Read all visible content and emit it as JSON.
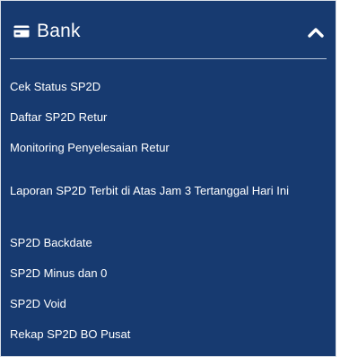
{
  "panel": {
    "title": "Bank",
    "icon": "credit-card-icon",
    "toggle_icon": "chevron-up-icon",
    "background_color": "#173a70"
  },
  "menu": {
    "items": [
      {
        "label": "Cek Status SP2D"
      },
      {
        "label": "Daftar SP2D Retur"
      },
      {
        "label": "Monitoring Penyelesaian Retur"
      },
      {
        "label": "Laporan SP2D Terbit di Atas Jam 3 Tertanggal Hari Ini"
      },
      {
        "label": "SP2D Backdate"
      },
      {
        "label": "SP2D Minus dan 0"
      },
      {
        "label": "SP2D Void"
      },
      {
        "label": "Rekap SP2D BO Pusat"
      }
    ]
  }
}
